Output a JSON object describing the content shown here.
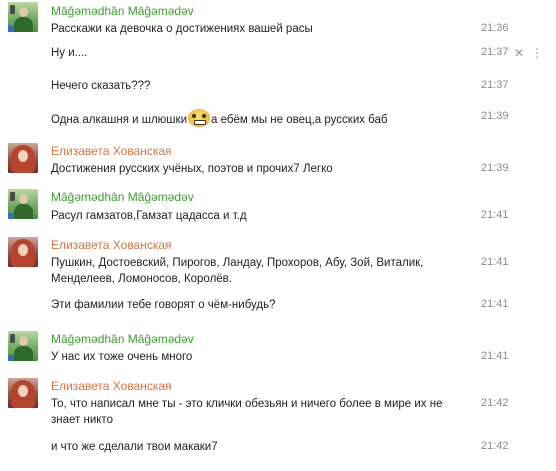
{
  "messages": [
    {
      "id": "g1",
      "author": "Mâĝəmədhân Mâĝəmədəv",
      "author_color": "#3a9e2a",
      "lines": [
        {
          "text": "Расскажи ка девочка о достижениях вашей расы",
          "time": "21:36"
        },
        {
          "text": "Ну и....",
          "time": "21:37"
        },
        {
          "text": "Нечего сказать???",
          "time": "21:37"
        },
        {
          "text_before": "Одна алкашня и шлюшки",
          "emoticon": "grin-emoticon",
          "text_after": "а ебём мы не овец,а русских баб",
          "time": "21:39"
        }
      ]
    },
    {
      "id": "g2",
      "author": "Елизавета Хованская",
      "author_color": "#d9733a",
      "lines": [
        {
          "text": "Достижения русских учёных, поэтов и прочих7 Легко",
          "time": "21:39"
        }
      ]
    },
    {
      "id": "g3",
      "author": "Mâĝəmədhân Mâĝəmədəv",
      "author_color": "#3a9e2a",
      "lines": [
        {
          "text": "Расул гамзатов,Гамзат цадасса и т.д",
          "time": "21:41"
        }
      ]
    },
    {
      "id": "g4",
      "author": "Елизавета Хованская",
      "author_color": "#d9733a",
      "lines": [
        {
          "text": "Пушкин, Достоевский, Пирогов, Ландау, Прохоров, Абу, Зой, Виталик, Менделеев, Ломоносов, Королёв.",
          "time": "21:41"
        },
        {
          "text": "Эти фамилии тебе говорят о чём-нибудь?",
          "time": "21:41"
        }
      ]
    },
    {
      "id": "g5",
      "author": "Mâĝəmədhân Mâĝəmədəv",
      "author_color": "#3a9e2a",
      "lines": [
        {
          "text": "У нас их тоже очень много",
          "time": "21:41"
        }
      ]
    },
    {
      "id": "g6",
      "author": "Елизавета Хованская",
      "author_color": "#d9733a",
      "lines": [
        {
          "text": "То, что написал мне ты - это клички обезьян и ничего более в мире их не знает никто",
          "time": "21:42"
        },
        {
          "text": "и что же сделали твои макаки7",
          "time": "21:42"
        }
      ]
    }
  ],
  "row_controls": {
    "close": "✕",
    "more": "⋮"
  }
}
